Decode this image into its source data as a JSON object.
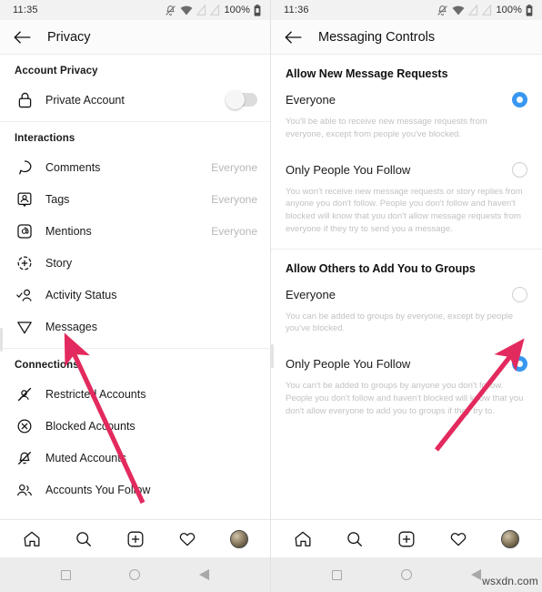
{
  "accent": {
    "blue": "#3897f0",
    "arrow": "#e32a5e",
    "muted": "#c2c2c2"
  },
  "watermark": "wsxdn.com",
  "left_phone": {
    "status": {
      "time": "11:35",
      "battery_pct": "100%",
      "icons": [
        "bell-off-icon",
        "wifi-icon",
        "signal-icon",
        "signal-icon",
        "battery-icon"
      ]
    },
    "appbar": {
      "back": "back-arrow-icon",
      "title": "Privacy"
    },
    "sections": [
      {
        "heading": "Account Privacy",
        "rows": [
          {
            "icon": "lock-icon",
            "label": "Private Account",
            "control": "toggle",
            "toggle_on": false
          }
        ]
      },
      {
        "heading": "Interactions",
        "rows": [
          {
            "icon": "comment-icon",
            "label": "Comments",
            "value": "Everyone"
          },
          {
            "icon": "tag-icon",
            "label": "Tags",
            "value": "Everyone"
          },
          {
            "icon": "mention-icon",
            "label": "Mentions",
            "value": "Everyone"
          },
          {
            "icon": "story-plus-icon",
            "label": "Story",
            "value": ""
          },
          {
            "icon": "activity-status-icon",
            "label": "Activity Status",
            "value": ""
          },
          {
            "icon": "messages-send-icon",
            "label": "Messages",
            "value": ""
          }
        ]
      },
      {
        "heading": "Connections",
        "rows": [
          {
            "icon": "restricted-icon",
            "label": "Restricted Accounts",
            "value": ""
          },
          {
            "icon": "blocked-icon",
            "label": "Blocked Accounts",
            "value": ""
          },
          {
            "icon": "muted-bell-icon",
            "label": "Muted Accounts",
            "value": ""
          },
          {
            "icon": "people-icon",
            "label": "Accounts You Follow",
            "value": ""
          }
        ]
      }
    ],
    "bottomnav": [
      "home-icon",
      "search-icon",
      "add-post-icon",
      "heart-icon",
      "profile-avatar"
    ],
    "sysnav": [
      "recents-square-icon",
      "home-circle-icon",
      "back-triangle-icon"
    ]
  },
  "right_phone": {
    "status": {
      "time": "11:36",
      "battery_pct": "100%",
      "icons": [
        "bell-off-icon",
        "wifi-icon",
        "signal-icon",
        "signal-icon",
        "battery-icon"
      ]
    },
    "appbar": {
      "back": "back-arrow-icon",
      "title": "Messaging Controls"
    },
    "groups": [
      {
        "heading": "Allow New Message Requests",
        "options": [
          {
            "label": "Everyone",
            "selected": true,
            "description": "You'll be able to receive new message requests from everyone, except from people you've blocked."
          },
          {
            "label": "Only People You Follow",
            "selected": false,
            "description": "You won't receive new message requests or story replies from anyone you don't follow. People you don't follow and haven't blocked will know that you don't allow message requests from everyone if they try to send you a message."
          }
        ]
      },
      {
        "heading": "Allow Others to Add You to Groups",
        "options": [
          {
            "label": "Everyone",
            "selected": false,
            "description": "You can be added to groups by everyone, except by people you've blocked."
          },
          {
            "label": "Only People You Follow",
            "selected": true,
            "description": "You can't be added to groups by anyone you don't follow. People you don't follow and haven't blocked will know that you don't allow everyone to add you to groups if they try to."
          }
        ]
      }
    ],
    "bottomnav": [
      "home-icon",
      "search-icon",
      "add-post-icon",
      "heart-icon",
      "profile-avatar"
    ],
    "sysnav": [
      "recents-square-icon",
      "home-circle-icon",
      "back-triangle-icon"
    ]
  }
}
